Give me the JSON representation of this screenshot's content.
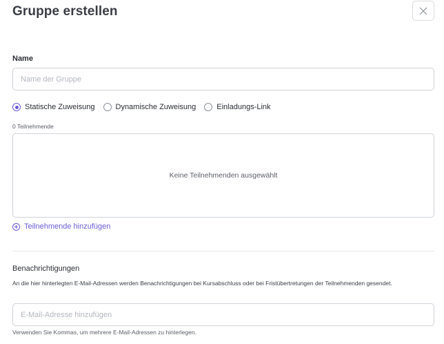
{
  "dialog": {
    "title": "Gruppe erstellen",
    "close_icon": "close-icon"
  },
  "name_field": {
    "label": "Name",
    "placeholder": "Name der Gruppe",
    "value": ""
  },
  "assignment": {
    "options": [
      {
        "label": "Statische Zuweisung",
        "selected": true
      },
      {
        "label": "Dynamische Zuweisung",
        "selected": false
      },
      {
        "label": "Einladungs-Link",
        "selected": false
      }
    ]
  },
  "participants": {
    "count_label": "0 Teilnehmende",
    "empty_text": "Keine Teilnehmenden ausgewählt",
    "add_label": "Teilnehmende hinzufügen"
  },
  "notifications": {
    "label": "Benachrichtigungen",
    "description": "An die hier hinterlegten E-Mail-Adressen werden Benachrichtigungen bei Kursabschluss oder bei Fristübertretungen der Teilnehmenden gesendet.",
    "placeholder": "E-Mail-Adresse hinzufügen",
    "value": "",
    "help": "Verwenden Sie Kommas, um mehrere E-Mail-Adressen zu hinterlegen."
  },
  "colors": {
    "accent": "#6b5bd6",
    "border": "#cfd2d8",
    "text": "#2b2d33"
  }
}
